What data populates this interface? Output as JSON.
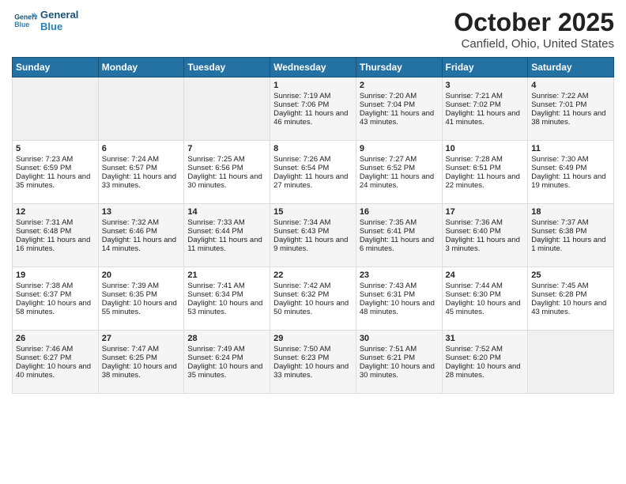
{
  "header": {
    "logo_line1": "General",
    "logo_line2": "Blue",
    "title": "October 2025",
    "subtitle": "Canfield, Ohio, United States"
  },
  "days_of_week": [
    "Sunday",
    "Monday",
    "Tuesday",
    "Wednesday",
    "Thursday",
    "Friday",
    "Saturday"
  ],
  "weeks": [
    [
      {
        "day": "",
        "empty": true
      },
      {
        "day": "",
        "empty": true
      },
      {
        "day": "",
        "empty": true
      },
      {
        "day": "1",
        "sunrise": "7:19 AM",
        "sunset": "7:06 PM",
        "daylight": "11 hours and 46 minutes."
      },
      {
        "day": "2",
        "sunrise": "7:20 AM",
        "sunset": "7:04 PM",
        "daylight": "11 hours and 43 minutes."
      },
      {
        "day": "3",
        "sunrise": "7:21 AM",
        "sunset": "7:02 PM",
        "daylight": "11 hours and 41 minutes."
      },
      {
        "day": "4",
        "sunrise": "7:22 AM",
        "sunset": "7:01 PM",
        "daylight": "11 hours and 38 minutes."
      }
    ],
    [
      {
        "day": "5",
        "sunrise": "7:23 AM",
        "sunset": "6:59 PM",
        "daylight": "11 hours and 35 minutes."
      },
      {
        "day": "6",
        "sunrise": "7:24 AM",
        "sunset": "6:57 PM",
        "daylight": "11 hours and 33 minutes."
      },
      {
        "day": "7",
        "sunrise": "7:25 AM",
        "sunset": "6:56 PM",
        "daylight": "11 hours and 30 minutes."
      },
      {
        "day": "8",
        "sunrise": "7:26 AM",
        "sunset": "6:54 PM",
        "daylight": "11 hours and 27 minutes."
      },
      {
        "day": "9",
        "sunrise": "7:27 AM",
        "sunset": "6:52 PM",
        "daylight": "11 hours and 24 minutes."
      },
      {
        "day": "10",
        "sunrise": "7:28 AM",
        "sunset": "6:51 PM",
        "daylight": "11 hours and 22 minutes."
      },
      {
        "day": "11",
        "sunrise": "7:30 AM",
        "sunset": "6:49 PM",
        "daylight": "11 hours and 19 minutes."
      }
    ],
    [
      {
        "day": "12",
        "sunrise": "7:31 AM",
        "sunset": "6:48 PM",
        "daylight": "11 hours and 16 minutes."
      },
      {
        "day": "13",
        "sunrise": "7:32 AM",
        "sunset": "6:46 PM",
        "daylight": "11 hours and 14 minutes."
      },
      {
        "day": "14",
        "sunrise": "7:33 AM",
        "sunset": "6:44 PM",
        "daylight": "11 hours and 11 minutes."
      },
      {
        "day": "15",
        "sunrise": "7:34 AM",
        "sunset": "6:43 PM",
        "daylight": "11 hours and 9 minutes."
      },
      {
        "day": "16",
        "sunrise": "7:35 AM",
        "sunset": "6:41 PM",
        "daylight": "11 hours and 6 minutes."
      },
      {
        "day": "17",
        "sunrise": "7:36 AM",
        "sunset": "6:40 PM",
        "daylight": "11 hours and 3 minutes."
      },
      {
        "day": "18",
        "sunrise": "7:37 AM",
        "sunset": "6:38 PM",
        "daylight": "11 hours and 1 minute."
      }
    ],
    [
      {
        "day": "19",
        "sunrise": "7:38 AM",
        "sunset": "6:37 PM",
        "daylight": "10 hours and 58 minutes."
      },
      {
        "day": "20",
        "sunrise": "7:39 AM",
        "sunset": "6:35 PM",
        "daylight": "10 hours and 55 minutes."
      },
      {
        "day": "21",
        "sunrise": "7:41 AM",
        "sunset": "6:34 PM",
        "daylight": "10 hours and 53 minutes."
      },
      {
        "day": "22",
        "sunrise": "7:42 AM",
        "sunset": "6:32 PM",
        "daylight": "10 hours and 50 minutes."
      },
      {
        "day": "23",
        "sunrise": "7:43 AM",
        "sunset": "6:31 PM",
        "daylight": "10 hours and 48 minutes."
      },
      {
        "day": "24",
        "sunrise": "7:44 AM",
        "sunset": "6:30 PM",
        "daylight": "10 hours and 45 minutes."
      },
      {
        "day": "25",
        "sunrise": "7:45 AM",
        "sunset": "6:28 PM",
        "daylight": "10 hours and 43 minutes."
      }
    ],
    [
      {
        "day": "26",
        "sunrise": "7:46 AM",
        "sunset": "6:27 PM",
        "daylight": "10 hours and 40 minutes."
      },
      {
        "day": "27",
        "sunrise": "7:47 AM",
        "sunset": "6:25 PM",
        "daylight": "10 hours and 38 minutes."
      },
      {
        "day": "28",
        "sunrise": "7:49 AM",
        "sunset": "6:24 PM",
        "daylight": "10 hours and 35 minutes."
      },
      {
        "day": "29",
        "sunrise": "7:50 AM",
        "sunset": "6:23 PM",
        "daylight": "10 hours and 33 minutes."
      },
      {
        "day": "30",
        "sunrise": "7:51 AM",
        "sunset": "6:21 PM",
        "daylight": "10 hours and 30 minutes."
      },
      {
        "day": "31",
        "sunrise": "7:52 AM",
        "sunset": "6:20 PM",
        "daylight": "10 hours and 28 minutes."
      },
      {
        "day": "",
        "empty": true
      }
    ]
  ]
}
